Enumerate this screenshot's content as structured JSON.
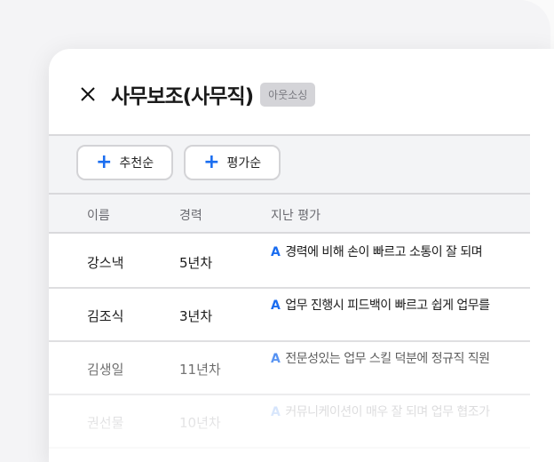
{
  "header": {
    "title": "사무보조(사무직)",
    "badge": "아웃소싱"
  },
  "sort_buttons": [
    {
      "label": "추천순"
    },
    {
      "label": "평가순"
    }
  ],
  "table": {
    "columns": [
      "이름",
      "경력",
      "지난 평가"
    ],
    "rows": [
      {
        "name": "강스낵",
        "career": "5년차",
        "grade": "A",
        "review": "경력에 비해 손이 빠르고 소통이 잘 되며"
      },
      {
        "name": "김조식",
        "career": "3년차",
        "grade": "A",
        "review": "업무 진행시 피드백이 빠르고 쉽게 업무를"
      },
      {
        "name": "김생일",
        "career": "11년차",
        "grade": "A",
        "review": "전문성있는 업무 스킬 덕분에 정규직 직원"
      },
      {
        "name": "권선물",
        "career": "10년차",
        "grade": "A",
        "review": "커뮤니케이션이 매우 잘 되며 업무 협조가"
      }
    ]
  }
}
